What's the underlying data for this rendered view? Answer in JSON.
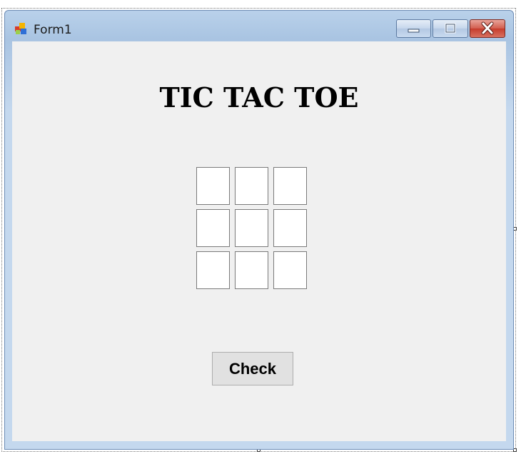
{
  "window": {
    "title": "Form1",
    "icon": "winforms-app-icon",
    "controls": [
      "minimize-icon",
      "maximize-icon",
      "close-icon"
    ]
  },
  "main": {
    "heading": "TIC TAC TOE",
    "board": [
      "",
      "",
      "",
      "",
      "",
      "",
      "",
      "",
      ""
    ],
    "check_label": "Check"
  },
  "colors": {
    "client_bg": "#f0f0f0",
    "frame": "#c4d8ee",
    "close_button": "#c63d2d"
  }
}
